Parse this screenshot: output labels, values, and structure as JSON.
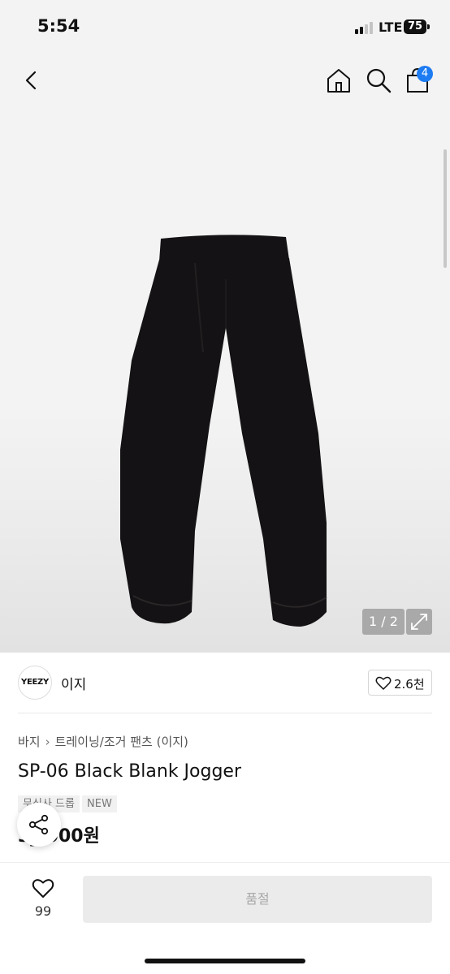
{
  "status_bar": {
    "time": "5:54",
    "network": "LTE",
    "battery": "75"
  },
  "header": {
    "cart_count": "4"
  },
  "gallery": {
    "counter": "1 / 2"
  },
  "brand": {
    "logo_text": "YEEZY",
    "name": "이지",
    "like_count": "2.6천"
  },
  "breadcrumb": {
    "category": "바지",
    "subcategory": "트레이닝/조거 팬츠 (이지)"
  },
  "product": {
    "title": "SP-06 Black Blank Jogger",
    "tags": [
      "무신사 드롭",
      "NEW"
    ],
    "price": "3_,000원"
  },
  "bottom_bar": {
    "like_count": "99",
    "soldout_label": "품절"
  },
  "colors": {
    "accent": "#1e7cf2",
    "product": "#141214"
  }
}
